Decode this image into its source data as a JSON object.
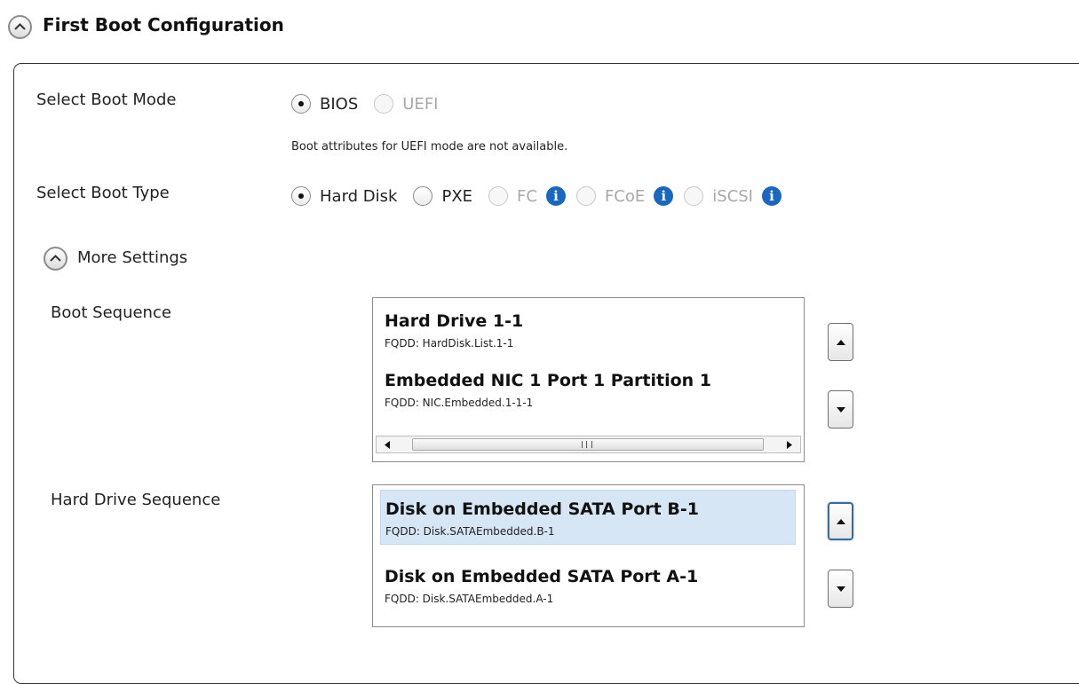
{
  "section": {
    "title": "First Boot Configuration"
  },
  "boot_mode": {
    "label": "Select Boot Mode",
    "options": [
      {
        "label": "BIOS",
        "checked": true,
        "disabled": false
      },
      {
        "label": "UEFI",
        "checked": false,
        "disabled": true
      }
    ],
    "note": "Boot attributes for UEFI mode are not available."
  },
  "boot_type": {
    "label": "Select Boot Type",
    "options": [
      {
        "label": "Hard Disk",
        "checked": true,
        "disabled": false
      },
      {
        "label": "PXE",
        "checked": false,
        "disabled": false
      },
      {
        "label": "FC",
        "checked": false,
        "disabled": true,
        "info_icon": "info-icon"
      },
      {
        "label": "FCoE",
        "checked": false,
        "disabled": true,
        "info_icon": "info-icon"
      },
      {
        "label": "iSCSI",
        "checked": false,
        "disabled": true,
        "info_icon": "info-icon"
      }
    ]
  },
  "more_settings": {
    "label": "More Settings"
  },
  "boot_sequence": {
    "label": "Boot Sequence",
    "items": [
      {
        "name": "Hard Drive 1-1",
        "fqdd": "FQDD: HardDisk.List.1-1"
      },
      {
        "name": "Embedded NIC 1 Port 1 Partition 1",
        "fqdd": "FQDD: NIC.Embedded.1-1-1"
      }
    ]
  },
  "hard_drive_sequence": {
    "label": "Hard Drive Sequence",
    "items": [
      {
        "name": "Disk on Embedded SATA Port B-1",
        "fqdd": "FQDD: Disk.SATAEmbedded.B-1",
        "selected": true
      },
      {
        "name": "Disk on Embedded SATA Port A-1",
        "fqdd": "FQDD: Disk.SATAEmbedded.A-1",
        "selected": false
      }
    ]
  },
  "colors": {
    "info_icon": "#1867c0",
    "selected_item": "#d7e6f5",
    "panel_border": "#333333"
  }
}
